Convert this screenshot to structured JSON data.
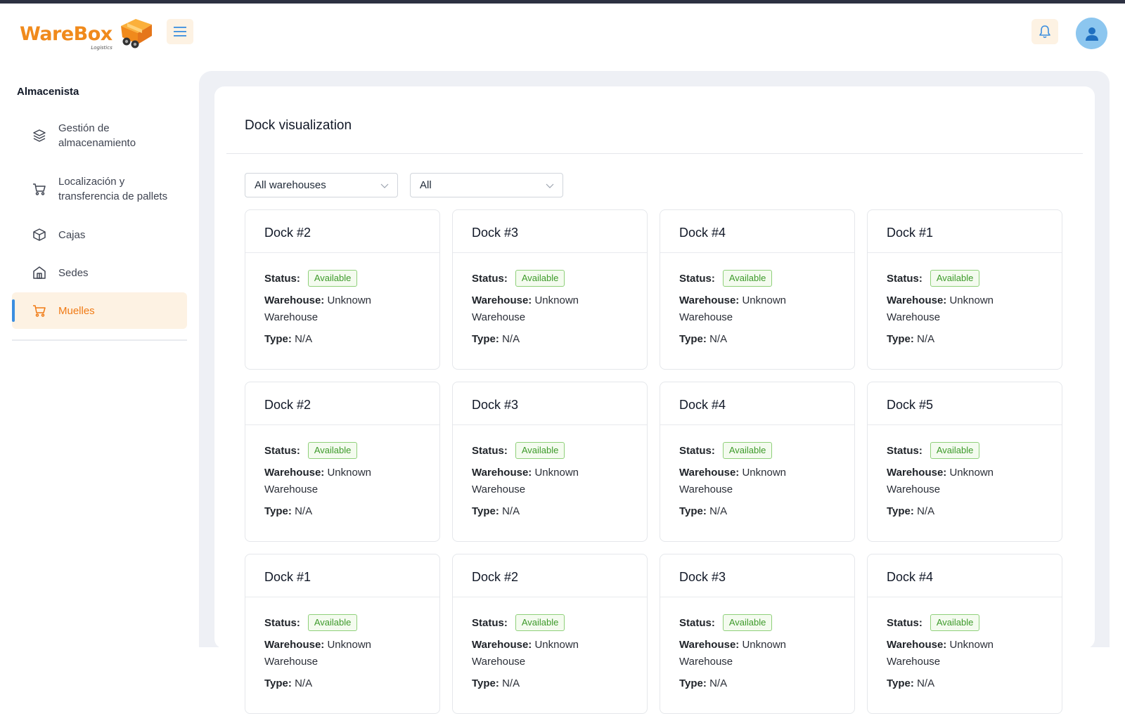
{
  "brand": {
    "name": "WareBox",
    "sub": "Logistics"
  },
  "sidebar": {
    "title": "Almacenista",
    "items": [
      {
        "label": "Gestión de almacenamiento",
        "icon": "layers-icon"
      },
      {
        "label": "Localización y transferencia de pallets",
        "icon": "cart-icon"
      },
      {
        "label": "Cajas",
        "icon": "box-icon"
      },
      {
        "label": "Sedes",
        "icon": "building-icon"
      },
      {
        "label": "Muelles",
        "icon": "cart-icon",
        "active": true
      }
    ]
  },
  "main": {
    "title": "Dock visualization",
    "filters": {
      "warehouse": "All warehouses",
      "type": "All"
    },
    "labels": {
      "status": "Status:",
      "warehouse": "Warehouse:",
      "type": "Type:"
    },
    "docks": [
      {
        "name": "Dock #2",
        "status": "Available",
        "warehouse": "Unknown Warehouse",
        "type": "N/A"
      },
      {
        "name": "Dock #3",
        "status": "Available",
        "warehouse": "Unknown Warehouse",
        "type": "N/A"
      },
      {
        "name": "Dock #4",
        "status": "Available",
        "warehouse": "Unknown Warehouse",
        "type": "N/A"
      },
      {
        "name": "Dock #1",
        "status": "Available",
        "warehouse": "Unknown Warehouse",
        "type": "N/A"
      },
      {
        "name": "Dock #2",
        "status": "Available",
        "warehouse": "Unknown Warehouse",
        "type": "N/A"
      },
      {
        "name": "Dock #3",
        "status": "Available",
        "warehouse": "Unknown Warehouse",
        "type": "N/A"
      },
      {
        "name": "Dock #4",
        "status": "Available",
        "warehouse": "Unknown Warehouse",
        "type": "N/A"
      },
      {
        "name": "Dock #5",
        "status": "Available",
        "warehouse": "Unknown Warehouse",
        "type": "N/A"
      },
      {
        "name": "Dock #1",
        "status": "Available",
        "warehouse": "Unknown Warehouse",
        "type": "N/A"
      },
      {
        "name": "Dock #2",
        "status": "Available",
        "warehouse": "Unknown Warehouse",
        "type": "N/A"
      },
      {
        "name": "Dock #3",
        "status": "Available",
        "warehouse": "Unknown Warehouse",
        "type": "N/A"
      },
      {
        "name": "Dock #4",
        "status": "Available",
        "warehouse": "Unknown Warehouse",
        "type": "N/A"
      }
    ]
  },
  "colors": {
    "accent": "#f07a14",
    "accent_bg": "#fdf2e3",
    "active_bar": "#3b8ee0",
    "badge_green": "#3d9a2a",
    "avatar": "#8cc6ef"
  }
}
